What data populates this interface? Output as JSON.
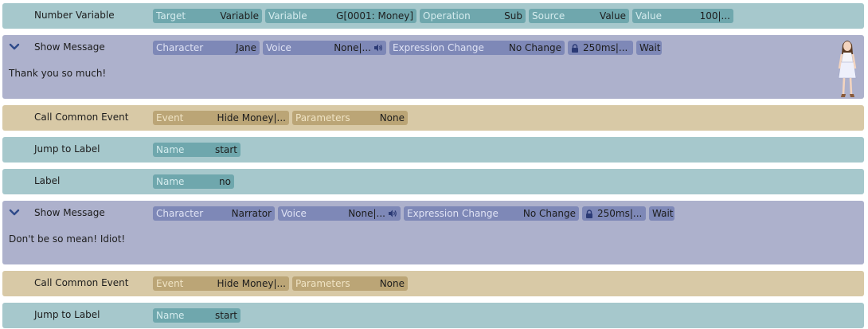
{
  "rows": [
    {
      "command": "Number Variable",
      "params": [
        {
          "label": "Target",
          "value": "Variable"
        },
        {
          "label": "Variable",
          "value": "G[0001: Money]"
        },
        {
          "label": "Operation",
          "value": "Sub"
        },
        {
          "label": "Source",
          "value": "Value"
        },
        {
          "label": "Value",
          "value": "100|..."
        }
      ]
    },
    {
      "command": "Show Message",
      "params": [
        {
          "label": "Character",
          "value": "Jane"
        },
        {
          "label": "Voice",
          "value": "None|..."
        },
        {
          "label": "Expression Change",
          "value": "No Change"
        },
        {
          "value": "250ms|..."
        },
        {
          "value": "Wait"
        }
      ],
      "message": "Thank you so much!"
    },
    {
      "command": "Call Common Event",
      "params": [
        {
          "label": "Event",
          "value": "Hide Money|..."
        },
        {
          "label": "Parameters",
          "value": "None"
        }
      ]
    },
    {
      "command": "Jump to Label",
      "params": [
        {
          "label": "Name",
          "value": "start"
        }
      ]
    },
    {
      "command": "Label",
      "params": [
        {
          "label": "Name",
          "value": "no"
        }
      ]
    },
    {
      "command": "Show Message",
      "params": [
        {
          "label": "Character",
          "value": "Narrator"
        },
        {
          "label": "Voice",
          "value": "None|..."
        },
        {
          "label": "Expression Change",
          "value": "No Change"
        },
        {
          "value": "250ms|..."
        },
        {
          "value": "Wait"
        }
      ],
      "message": "Don't be so mean! Idiot!"
    },
    {
      "command": "Call Common Event",
      "params": [
        {
          "label": "Event",
          "value": "Hide Money|..."
        },
        {
          "label": "Parameters",
          "value": "None"
        }
      ]
    },
    {
      "command": "Jump to Label",
      "params": [
        {
          "label": "Name",
          "value": "start"
        }
      ]
    }
  ],
  "colors": {
    "teal_row": "#a6c8cc",
    "purple_row": "#adb1cc",
    "tan_row": "#d8c9a6",
    "teal_chip": "#6fa7ad",
    "purple_chip": "#7e88b7",
    "tan_chip": "#bba576"
  },
  "icons": {
    "collapse": "chevron-down-icon",
    "voice": "speaker-icon",
    "timing": "lock-icon",
    "portrait": "character-portrait"
  }
}
